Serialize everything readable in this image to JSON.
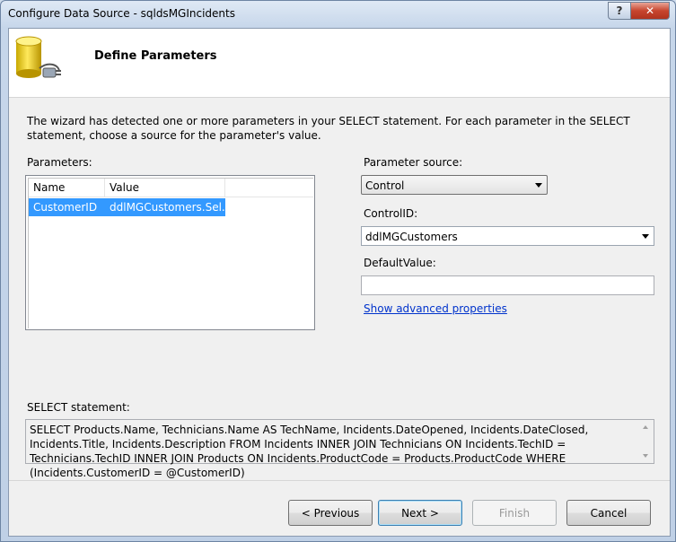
{
  "window": {
    "title": "Configure Data Source - sqldsMGIncidents",
    "help_glyph": "?",
    "close_glyph": "✕"
  },
  "header": {
    "title": "Define Parameters",
    "icon": "database-connect-icon"
  },
  "description": "The wizard has detected one or more parameters in your SELECT statement. For each parameter in the SELECT statement, choose a source for the parameter's value.",
  "parameters": {
    "label": "Parameters:",
    "columns": [
      "Name",
      "Value"
    ],
    "rows": [
      {
        "name": "CustomerID",
        "value": "ddlMGCustomers.Sel..."
      }
    ]
  },
  "parameter_source": {
    "label": "Parameter source:",
    "value": "Control"
  },
  "control_id": {
    "label": "ControlID:",
    "value": "ddlMGCustomers"
  },
  "default_value": {
    "label": "DefaultValue:",
    "value": ""
  },
  "advanced_link": "Show advanced properties",
  "select_statement": {
    "label": "SELECT statement:",
    "text": "SELECT Products.Name, Technicians.Name AS TechName, Incidents.DateOpened, Incidents.DateClosed, Incidents.Title, Incidents.Description FROM Incidents INNER JOIN Technicians ON Incidents.TechID = Technicians.TechID INNER JOIN Products ON Incidents.ProductCode = Products.ProductCode WHERE (Incidents.CustomerID = @CustomerID)"
  },
  "buttons": {
    "previous": "< Previous",
    "next": "Next >",
    "finish": "Finish",
    "cancel": "Cancel"
  },
  "colors": {
    "selection": "#3399ff",
    "link": "#0033cc"
  }
}
